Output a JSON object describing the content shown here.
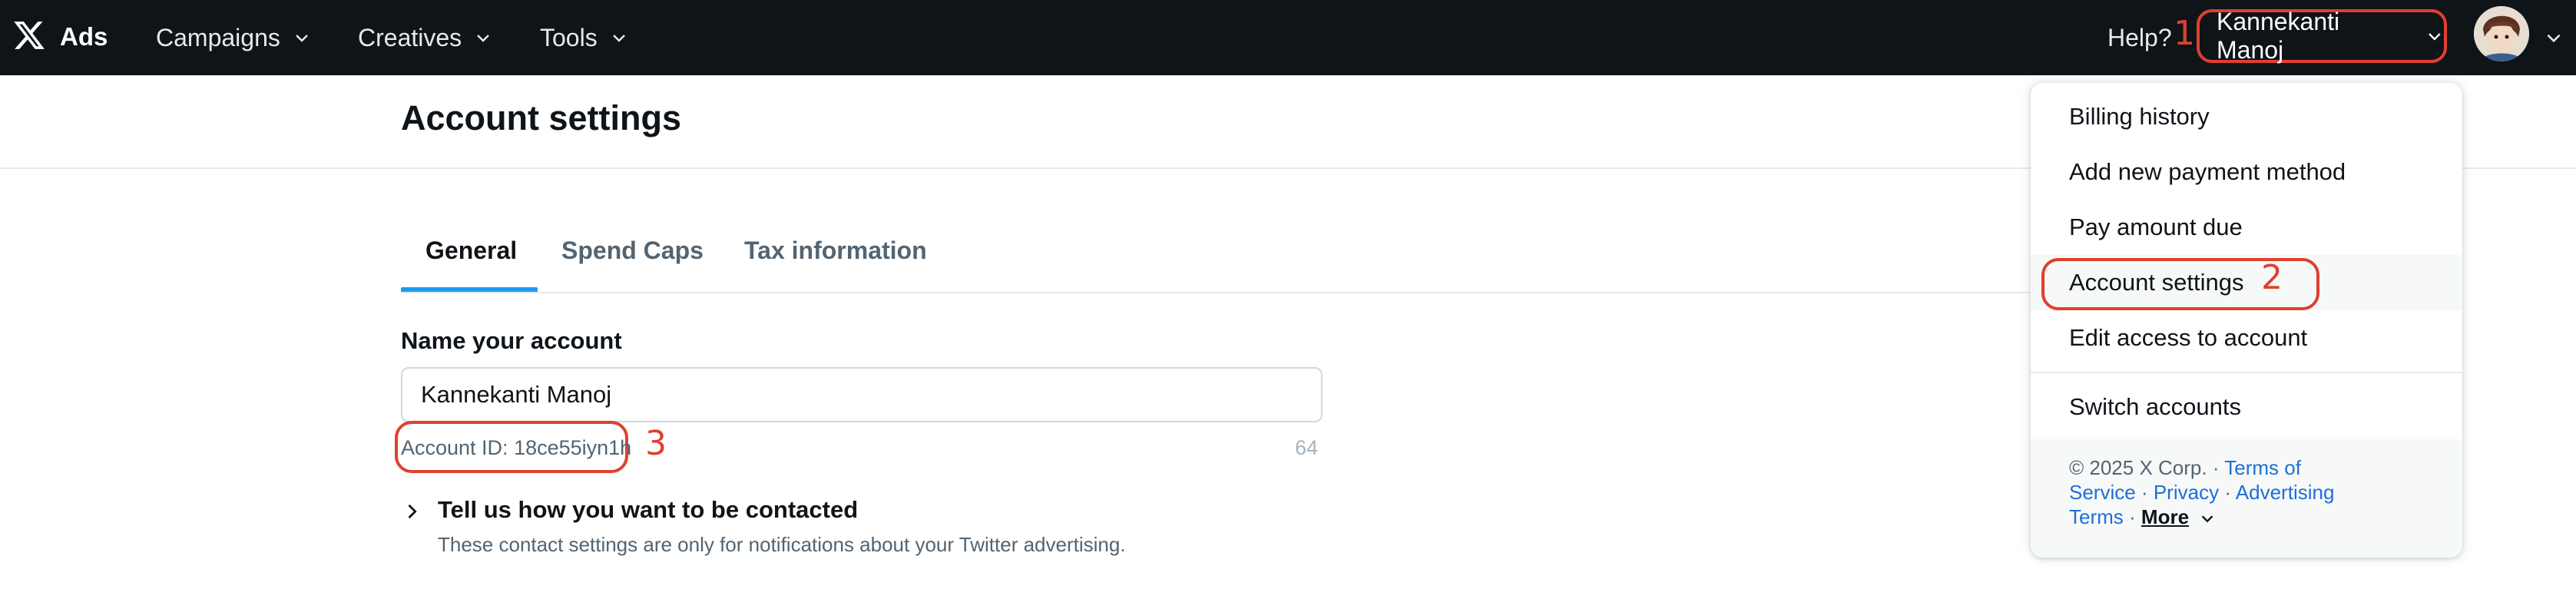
{
  "topbar": {
    "brand": "Ads",
    "nav": [
      {
        "label": "Campaigns"
      },
      {
        "label": "Creatives"
      },
      {
        "label": "Tools"
      }
    ],
    "help": "Help?",
    "account_name": "Kannekanti Manoj"
  },
  "annotations": {
    "one": "1",
    "two": "2",
    "three": "3"
  },
  "page": {
    "title": "Account settings"
  },
  "tabs": [
    {
      "label": "General",
      "active": true
    },
    {
      "label": "Spend Caps",
      "active": false
    },
    {
      "label": "Tax information",
      "active": false
    }
  ],
  "form": {
    "name_label": "Name your account",
    "name_value": "Kannekanti Manoj",
    "account_id": "Account ID: 18ce55iyn1h",
    "counter": "64",
    "contact_title": "Tell us how you want to be contacted",
    "contact_sub": "These contact settings are only for notifications about your Twitter advertising."
  },
  "menu": {
    "items": [
      {
        "label": "Billing history"
      },
      {
        "label": "Add new payment method"
      },
      {
        "label": "Pay amount due"
      },
      {
        "label": "Account settings"
      },
      {
        "label": "Edit access to account"
      },
      {
        "label": "Switch accounts"
      }
    ],
    "footer": {
      "copyright": "© 2025 X Corp. ·",
      "terms_of": "Terms of",
      "service": "Service",
      "privacy": "Privacy",
      "advertising": "Advertising",
      "terms": "Terms",
      "more": "More",
      "sep": "·"
    }
  },
  "colors": {
    "topbar_bg": "#0f1419",
    "annotation": "#e0402e",
    "tab_accent": "#1d9bf0",
    "link": "#1d6fd6"
  }
}
